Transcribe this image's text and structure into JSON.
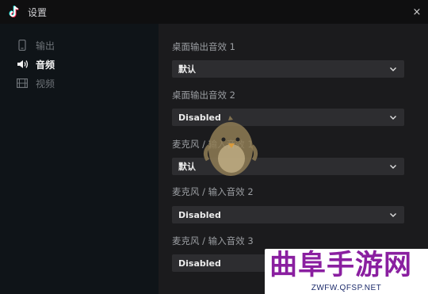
{
  "window": {
    "title": "设置",
    "close_glyph": "×"
  },
  "sidebar": {
    "items": [
      {
        "label": "输出",
        "icon": "phone-icon",
        "active": false
      },
      {
        "label": "音频",
        "icon": "speaker-icon",
        "active": true
      },
      {
        "label": "视频",
        "icon": "film-icon",
        "active": false
      }
    ]
  },
  "audio": {
    "fields": [
      {
        "label": "桌面输出音效 1",
        "value": "默认"
      },
      {
        "label": "桌面输出音效 2",
        "value": "Disabled"
      },
      {
        "label": "麦克风 / 输入音效 1",
        "value": "默认"
      },
      {
        "label": "麦克风 / 输入音效 2",
        "value": "Disabled"
      },
      {
        "label": "麦克风 / 输入音效 3",
        "value": "Disabled"
      }
    ]
  },
  "watermark": {
    "main": "曲阜手游网",
    "sub": "ZWFW.QFSP.NET"
  },
  "colors": {
    "titlebar": "#0f0f10",
    "sidebar": "#0f1418",
    "main_bg": "#1b1b1d",
    "select_bg": "#2d2d30",
    "logo_cyan": "#25f4ee",
    "logo_red": "#fe2c55",
    "watermark_purple": "#8a1fa0"
  }
}
